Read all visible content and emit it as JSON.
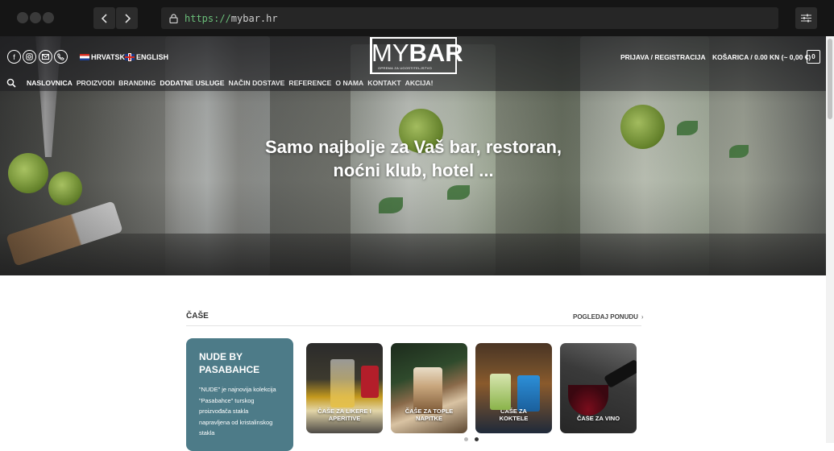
{
  "browser": {
    "url_protocol": "https://",
    "url_host": "mybar.hr"
  },
  "header": {
    "social": [
      "facebook-icon",
      "instagram-icon",
      "email-icon",
      "phone-icon"
    ],
    "lang_hr": "HRVATSKI",
    "lang_en": "ENGLISH",
    "logo_my": "MY",
    "logo_bar": "BAR",
    "logo_tagline": "OPREMA ZA UGOSTITELJSTVO",
    "account": "PRIJAVA / REGISTRACIJA",
    "cart": "KOŠARICA / 0.00 KN (~ 0,00 €)",
    "cart_count": "0"
  },
  "nav": {
    "items": [
      "NASLOVNICA",
      "PROIZVODI",
      "BRANDING",
      "DODATNE USLUGE",
      "NAČIN DOSTAVE",
      "REFERENCE",
      "O NAMA",
      "KONTAKT",
      "AKCIJA!"
    ]
  },
  "hero": {
    "line1": "Samo najbolje za Vaš bar, restoran,",
    "line2": "noćni klub, hotel ..."
  },
  "section": {
    "title": "ČAŠE",
    "view_offer": "POGLEDAJ PONUDU",
    "promo_title_1": "NUDE BY",
    "promo_title_2": "PASABAHCE",
    "promo_body": "\"NUDE\" je najnovija kolekcija \"Pasabahce\" turskog proizvođača stakla napravljena od kristalinskog stakla",
    "cards": [
      {
        "line1": "ČAŠE ZA LIKERE I",
        "line2": "APERITIVE"
      },
      {
        "line1": "ČAŠE ZA TOPLE",
        "line2": "NAPITKE"
      },
      {
        "line1": "ČAŠE ZA",
        "line2": "KOKTELE"
      },
      {
        "line1": "ČAŠE ZA VINO",
        "line2": ""
      }
    ],
    "carousel_pages": 2,
    "carousel_active": 2
  }
}
